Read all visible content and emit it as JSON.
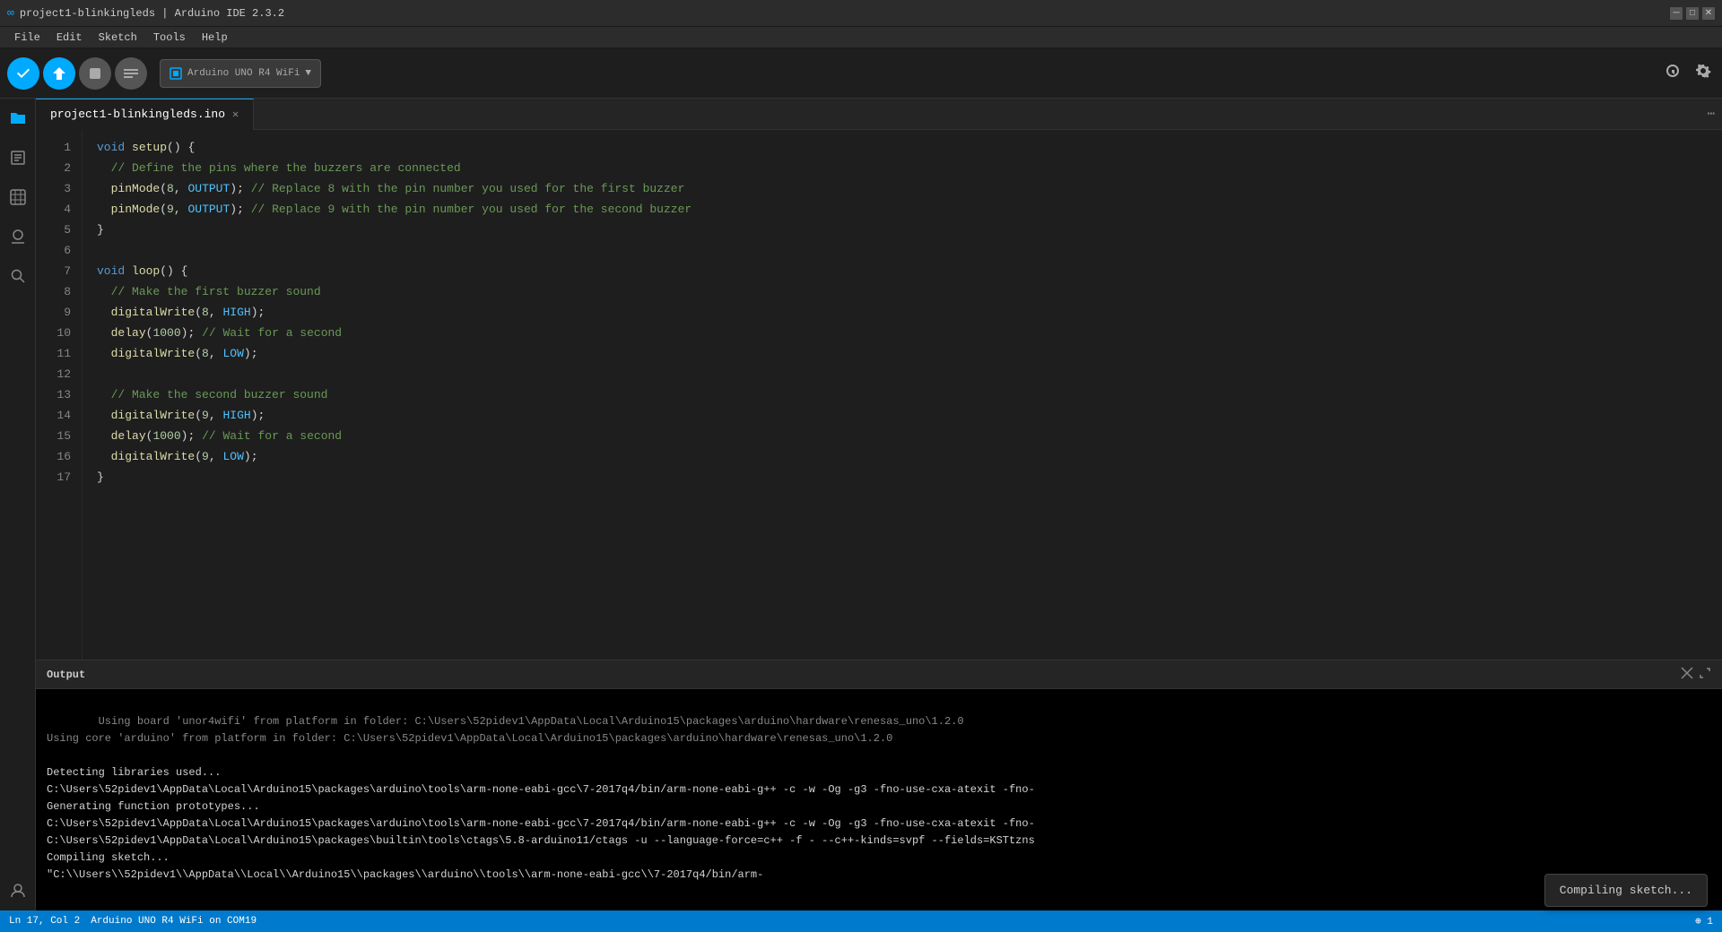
{
  "window": {
    "title": "project1-blinkingleds | Arduino IDE 2.3.2"
  },
  "menu": {
    "items": [
      "File",
      "Edit",
      "Sketch",
      "Tools",
      "Help"
    ]
  },
  "toolbar": {
    "verify_label": "✓",
    "upload_label": "→",
    "debug_label": "⬛",
    "serial_label": "≡",
    "board_name": "Arduino UNO R4 WiFi",
    "board_icon": "🔌"
  },
  "sidebar": {
    "icons": [
      "📁",
      "📝",
      "📊",
      "🔧",
      "🔍",
      "👤"
    ]
  },
  "tab": {
    "filename": "project1-blinkingleds.ino"
  },
  "code": {
    "lines": [
      "1",
      "2",
      "3",
      "4",
      "5",
      "6",
      "7",
      "8",
      "9",
      "10",
      "11",
      "12",
      "13",
      "14",
      "15",
      "16",
      "17"
    ]
  },
  "output": {
    "title": "Output",
    "content": "Using board 'unor4wifi' from platform in folder: C:\\Users\\52pidev1\\AppData\\Local\\Arduino15\\packages\\arduino\\hardware\\renesas_uno\\1.2.0\nUsing core 'arduino' from platform in folder: C:\\Users\\52pidev1\\AppData\\Local\\Arduino15\\packages\\arduino\\hardware\\renesas_uno\\1.2.0\n\nDetecting libraries used...\nC:\\Users\\52pidev1\\AppData\\Local\\Arduino15\\packages\\arduino\\tools\\arm-none-eabi-gcc\\7-2017q4/bin/arm-none-eabi-g++ -c -w -Og -g3 -fno-use-cxa-atexit -fno-\nGenerating function prototypes...\nC:\\Users\\52pidev1\\AppData\\Local\\Arduino15\\packages\\arduino\\tools\\arm-none-eabi-gcc\\7-2017q4/bin/arm-none-eabi-g++ -c -w -Og -g3 -fno-use-cxa-atexit -fno-\nC:\\Users\\52pidev1\\AppData\\Local\\Arduino15\\packages\\builtin\\tools\\ctags\\5.8-arduino11/ctags -u --language-force=c++ -f - --c++-kinds=svpf --fields=KSTtzns\nCompiling sketch...\n\"C:\\\\Users\\\\52pidev1\\\\AppData\\\\Local\\\\Arduino15\\\\packages\\\\arduino\\\\tools\\\\arm-none-eabi-gcc\\\\7-2017q4/bin/arm-"
  },
  "compiling_popup": {
    "text": "Compiling sketch..."
  },
  "status_bar": {
    "position": "Ln 17, Col 2",
    "board": "Arduino UNO R4 WiFi on COM19",
    "indicator": "⊕ 1"
  }
}
